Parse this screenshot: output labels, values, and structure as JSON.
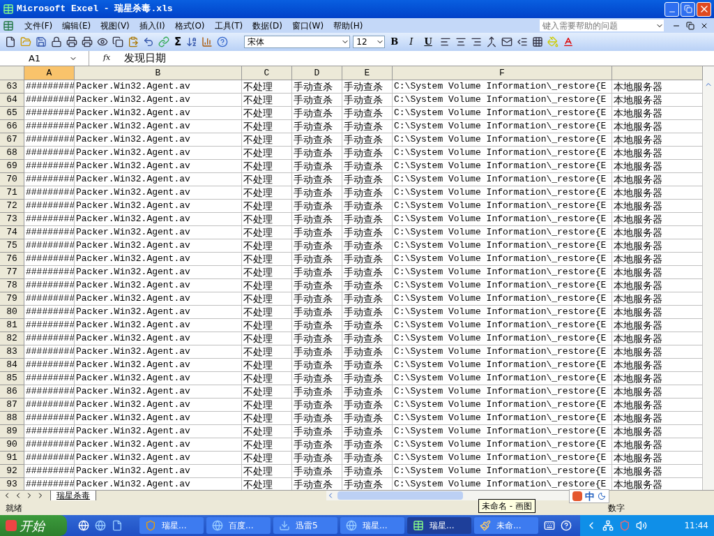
{
  "window": {
    "title": "Microsoft Excel - 瑞星杀毒.xls"
  },
  "menu": [
    "文件(F)",
    "编辑(E)",
    "视图(V)",
    "插入(I)",
    "格式(O)",
    "工具(T)",
    "数据(D)",
    "窗口(W)",
    "帮助(H)"
  ],
  "help_box": {
    "placeholder": "键入需要帮助的问题"
  },
  "toolbar": {
    "sum_symbol": "Σ",
    "font": "宋体",
    "size": "12",
    "bold": "B",
    "italic": "I",
    "underline": "U"
  },
  "formula_bar": {
    "name_box": "A1",
    "fx": "fx",
    "value": "发现日期"
  },
  "columns": [
    {
      "label": "A",
      "selected": true
    },
    {
      "label": "B",
      "selected": false
    },
    {
      "label": "C",
      "selected": false
    },
    {
      "label": "D",
      "selected": false
    },
    {
      "label": "E",
      "selected": false
    },
    {
      "label": "F",
      "selected": false
    }
  ],
  "rows": [
    {
      "num": "63",
      "cells": [
        "#########",
        "Packer.Win32.Agent.av",
        "不处理",
        "手动查杀",
        "手动查杀",
        "C:\\System Volume Information\\_restore{E",
        "本地服务器"
      ]
    },
    {
      "num": "64",
      "cells": [
        "#########",
        "Packer.Win32.Agent.av",
        "不处理",
        "手动查杀",
        "手动查杀",
        "C:\\System Volume Information\\_restore{E",
        "本地服务器"
      ]
    },
    {
      "num": "65",
      "cells": [
        "#########",
        "Packer.Win32.Agent.av",
        "不处理",
        "手动查杀",
        "手动查杀",
        "C:\\System Volume Information\\_restore{E",
        "本地服务器"
      ]
    },
    {
      "num": "66",
      "cells": [
        "#########",
        "Packer.Win32.Agent.av",
        "不处理",
        "手动查杀",
        "手动查杀",
        "C:\\System Volume Information\\_restore{E",
        "本地服务器"
      ]
    },
    {
      "num": "67",
      "cells": [
        "#########",
        "Packer.Win32.Agent.av",
        "不处理",
        "手动查杀",
        "手动查杀",
        "C:\\System Volume Information\\_restore{E",
        "本地服务器"
      ]
    },
    {
      "num": "68",
      "cells": [
        "#########",
        "Packer.Win32.Agent.av",
        "不处理",
        "手动查杀",
        "手动查杀",
        "C:\\System Volume Information\\_restore{E",
        "本地服务器"
      ]
    },
    {
      "num": "69",
      "cells": [
        "#########",
        "Packer.Win32.Agent.av",
        "不处理",
        "手动查杀",
        "手动查杀",
        "C:\\System Volume Information\\_restore{E",
        "本地服务器"
      ]
    },
    {
      "num": "70",
      "cells": [
        "#########",
        "Packer.Win32.Agent.av",
        "不处理",
        "手动查杀",
        "手动查杀",
        "C:\\System Volume Information\\_restore{E",
        "本地服务器"
      ]
    },
    {
      "num": "71",
      "cells": [
        "#########",
        "Packer.Win32.Agent.av",
        "不处理",
        "手动查杀",
        "手动查杀",
        "C:\\System Volume Information\\_restore{E",
        "本地服务器"
      ]
    },
    {
      "num": "72",
      "cells": [
        "#########",
        "Packer.Win32.Agent.av",
        "不处理",
        "手动查杀",
        "手动查杀",
        "C:\\System Volume Information\\_restore{E",
        "本地服务器"
      ]
    },
    {
      "num": "73",
      "cells": [
        "#########",
        "Packer.Win32.Agent.av",
        "不处理",
        "手动查杀",
        "手动查杀",
        "C:\\System Volume Information\\_restore{E",
        "本地服务器"
      ]
    },
    {
      "num": "74",
      "cells": [
        "#########",
        "Packer.Win32.Agent.av",
        "不处理",
        "手动查杀",
        "手动查杀",
        "C:\\System Volume Information\\_restore{E",
        "本地服务器"
      ]
    },
    {
      "num": "75",
      "cells": [
        "#########",
        "Packer.Win32.Agent.av",
        "不处理",
        "手动查杀",
        "手动查杀",
        "C:\\System Volume Information\\_restore{E",
        "本地服务器"
      ]
    },
    {
      "num": "76",
      "cells": [
        "#########",
        "Packer.Win32.Agent.av",
        "不处理",
        "手动查杀",
        "手动查杀",
        "C:\\System Volume Information\\_restore{E",
        "本地服务器"
      ]
    },
    {
      "num": "77",
      "cells": [
        "#########",
        "Packer.Win32.Agent.av",
        "不处理",
        "手动查杀",
        "手动查杀",
        "C:\\System Volume Information\\_restore{E",
        "本地服务器"
      ]
    },
    {
      "num": "78",
      "cells": [
        "#########",
        "Packer.Win32.Agent.av",
        "不处理",
        "手动查杀",
        "手动查杀",
        "C:\\System Volume Information\\_restore{E",
        "本地服务器"
      ]
    },
    {
      "num": "79",
      "cells": [
        "#########",
        "Packer.Win32.Agent.av",
        "不处理",
        "手动查杀",
        "手动查杀",
        "C:\\System Volume Information\\_restore{E",
        "本地服务器"
      ]
    },
    {
      "num": "80",
      "cells": [
        "#########",
        "Packer.Win32.Agent.av",
        "不处理",
        "手动查杀",
        "手动查杀",
        "C:\\System Volume Information\\_restore{E",
        "本地服务器"
      ]
    },
    {
      "num": "81",
      "cells": [
        "#########",
        "Packer.Win32.Agent.av",
        "不处理",
        "手动查杀",
        "手动查杀",
        "C:\\System Volume Information\\_restore{E",
        "本地服务器"
      ]
    },
    {
      "num": "82",
      "cells": [
        "#########",
        "Packer.Win32.Agent.av",
        "不处理",
        "手动查杀",
        "手动查杀",
        "C:\\System Volume Information\\_restore{E",
        "本地服务器"
      ]
    },
    {
      "num": "83",
      "cells": [
        "#########",
        "Packer.Win32.Agent.av",
        "不处理",
        "手动查杀",
        "手动查杀",
        "C:\\System Volume Information\\_restore{E",
        "本地服务器"
      ]
    },
    {
      "num": "84",
      "cells": [
        "#########",
        "Packer.Win32.Agent.av",
        "不处理",
        "手动查杀",
        "手动查杀",
        "C:\\System Volume Information\\_restore{E",
        "本地服务器"
      ]
    },
    {
      "num": "85",
      "cells": [
        "#########",
        "Packer.Win32.Agent.av",
        "不处理",
        "手动查杀",
        "手动查杀",
        "C:\\System Volume Information\\_restore{E",
        "本地服务器"
      ]
    },
    {
      "num": "86",
      "cells": [
        "#########",
        "Packer.Win32.Agent.av",
        "不处理",
        "手动查杀",
        "手动查杀",
        "C:\\System Volume Information\\_restore{E",
        "本地服务器"
      ]
    },
    {
      "num": "87",
      "cells": [
        "#########",
        "Packer.Win32.Agent.av",
        "不处理",
        "手动查杀",
        "手动查杀",
        "C:\\System Volume Information\\_restore{E",
        "本地服务器"
      ]
    },
    {
      "num": "88",
      "cells": [
        "#########",
        "Packer.Win32.Agent.av",
        "不处理",
        "手动查杀",
        "手动查杀",
        "C:\\System Volume Information\\_restore{E",
        "本地服务器"
      ]
    },
    {
      "num": "89",
      "cells": [
        "#########",
        "Packer.Win32.Agent.av",
        "不处理",
        "手动查杀",
        "手动查杀",
        "C:\\System Volume Information\\_restore{E",
        "本地服务器"
      ]
    },
    {
      "num": "90",
      "cells": [
        "#########",
        "Packer.Win32.Agent.av",
        "不处理",
        "手动查杀",
        "手动查杀",
        "C:\\System Volume Information\\_restore{E",
        "本地服务器"
      ]
    },
    {
      "num": "91",
      "cells": [
        "#########",
        "Packer.Win32.Agent.av",
        "不处理",
        "手动查杀",
        "手动查杀",
        "C:\\System Volume Information\\_restore{E",
        "本地服务器"
      ]
    },
    {
      "num": "92",
      "cells": [
        "#########",
        "Packer.Win32.Agent.av",
        "不处理",
        "手动查杀",
        "手动查杀",
        "C:\\System Volume Information\\_restore{E",
        "本地服务器"
      ]
    },
    {
      "num": "93",
      "cells": [
        "#########",
        "Packer.Win32.Agent.av",
        "不处理",
        "手动查杀",
        "手动查杀",
        "C:\\System Volume Information\\_restore{E",
        "本地服务器"
      ]
    }
  ],
  "sheet_tabs": [
    {
      "label": "瑞星杀毒",
      "selected": true
    }
  ],
  "status_bar": {
    "left": "就绪",
    "right": "数字"
  },
  "tooltip": "未命名 - 画图",
  "ime_bar": {
    "mode": "中"
  },
  "taskbar": {
    "start": "开始",
    "tasks": [
      {
        "kind": "shield",
        "label": "瑞星...",
        "selected": false
      },
      {
        "kind": "browser",
        "label": "百度...",
        "selected": false
      },
      {
        "kind": "download",
        "label": "迅雷5",
        "selected": false
      },
      {
        "kind": "browser",
        "label": "瑞星...",
        "selected": false
      },
      {
        "kind": "spreadsheet",
        "label": "瑞星...",
        "selected": true
      },
      {
        "kind": "paint",
        "label": "未命...",
        "selected": false
      }
    ],
    "clock": "11:44"
  }
}
